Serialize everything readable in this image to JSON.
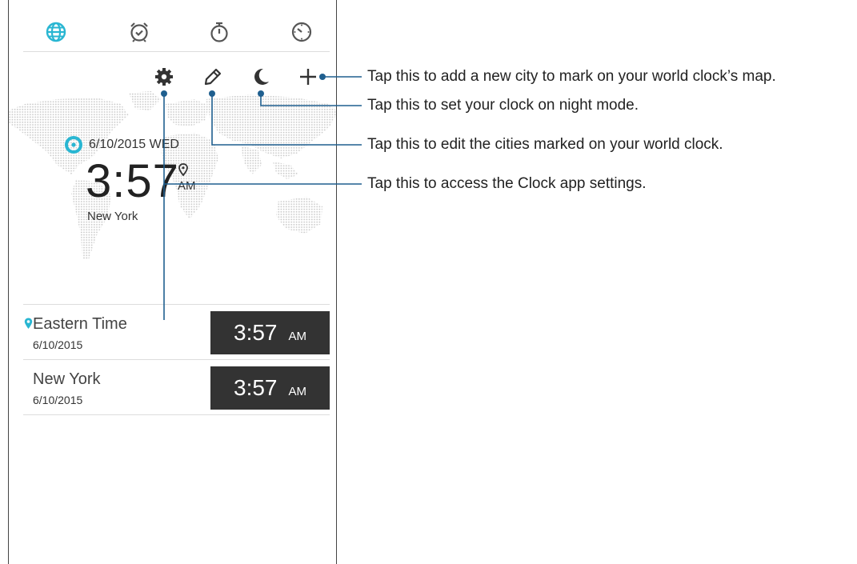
{
  "tabs": [
    {
      "icon": "globe-icon",
      "active": true
    },
    {
      "icon": "alarm-clock-icon",
      "active": false
    },
    {
      "icon": "stopwatch-icon",
      "active": false
    },
    {
      "icon": "timer-icon",
      "active": false
    }
  ],
  "actions": [
    {
      "icon": "settings-gear-icon"
    },
    {
      "icon": "edit-pencil-icon"
    },
    {
      "icon": "night-mode-moon-icon"
    },
    {
      "icon": "add-plus-icon"
    }
  ],
  "world_clock": {
    "date": "6/10/2015 WED",
    "time": "3:57",
    "ampm": "AM",
    "city": "New York"
  },
  "cities": [
    {
      "name": "Eastern Time",
      "date": "6/10/2015",
      "time": "3:57",
      "ampm": "AM",
      "current": true
    },
    {
      "name": "New York",
      "date": "6/10/2015",
      "time": "3:57",
      "ampm": "AM",
      "current": false
    }
  ],
  "callouts": [
    {
      "target": "add",
      "text": "Tap this to add a new city to mark on your world clock’s map."
    },
    {
      "target": "night",
      "text": "Tap this to set your clock on night mode."
    },
    {
      "target": "edit",
      "text": "Tap this to edit the cities marked on your world clock."
    },
    {
      "target": "settings",
      "text": "Tap this to access the Clock app settings."
    }
  ],
  "colors": {
    "accent": "#29b6d2",
    "callout_line": "#1f5f8f",
    "dark_box": "#333333",
    "map_dots": "#c8c8c8"
  }
}
